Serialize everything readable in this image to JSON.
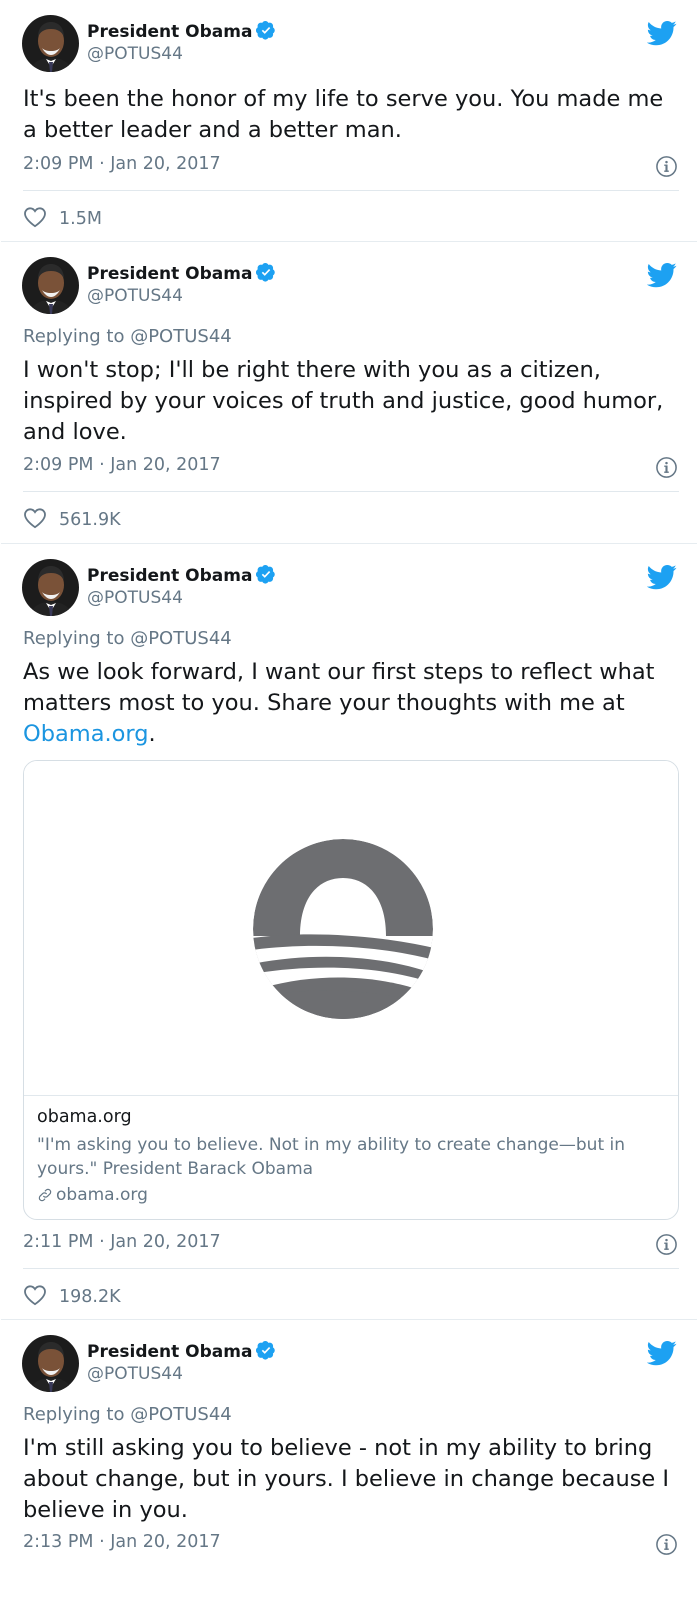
{
  "tweets": [
    {
      "author": {
        "name": "President Obama",
        "handle": "@POTUS44"
      },
      "replying_to": "",
      "text": "It's been the honor of my life to serve you. You made me a better leader and a better man.",
      "timestamp": "2:09 PM · Jan 20, 2017",
      "likes": "1.5M"
    },
    {
      "author": {
        "name": "President Obama",
        "handle": "@POTUS44"
      },
      "replying_to": "Replying to @POTUS44",
      "text": "I won't stop; I'll be right there with you as a citizen, inspired by your voices of truth and justice, good humor, and love.",
      "timestamp": "2:09 PM · Jan 20, 2017",
      "likes": "561.9K"
    },
    {
      "author": {
        "name": "President Obama",
        "handle": "@POTUS44"
      },
      "replying_to": "Replying to @POTUS44",
      "text_before_link": "As we look forward, I want our first steps to reflect what matters most to you. Share your thoughts with me at ",
      "link_text": "Obama.org",
      "text_after_link": ".",
      "card": {
        "title": "obama.org",
        "description": "\"I'm asking you to believe. Not in my ability to create change—but in yours.\" President Barack Obama",
        "domain": "obama.org"
      },
      "timestamp": "2:11 PM · Jan 20, 2017",
      "likes": "198.2K"
    },
    {
      "author": {
        "name": "President Obama",
        "handle": "@POTUS44"
      },
      "replying_to": "Replying to @POTUS44",
      "text": "I'm still asking you to believe - not in my ability to bring about change, but in yours. I believe in change because I believe in you.",
      "timestamp": "2:13 PM · Jan 20, 2017"
    }
  ],
  "icons": {
    "avatar": "avatar-photo",
    "verified": "verified-badge-icon",
    "brand": "twitter-bird-icon",
    "info": "info-icon",
    "like": "heart-icon",
    "link": "link-icon"
  },
  "colors": {
    "brand_blue": "#1da1f2",
    "link_blue": "#1b95e0",
    "secondary_text": "#657786",
    "logo_gray": "#6d6e71"
  }
}
